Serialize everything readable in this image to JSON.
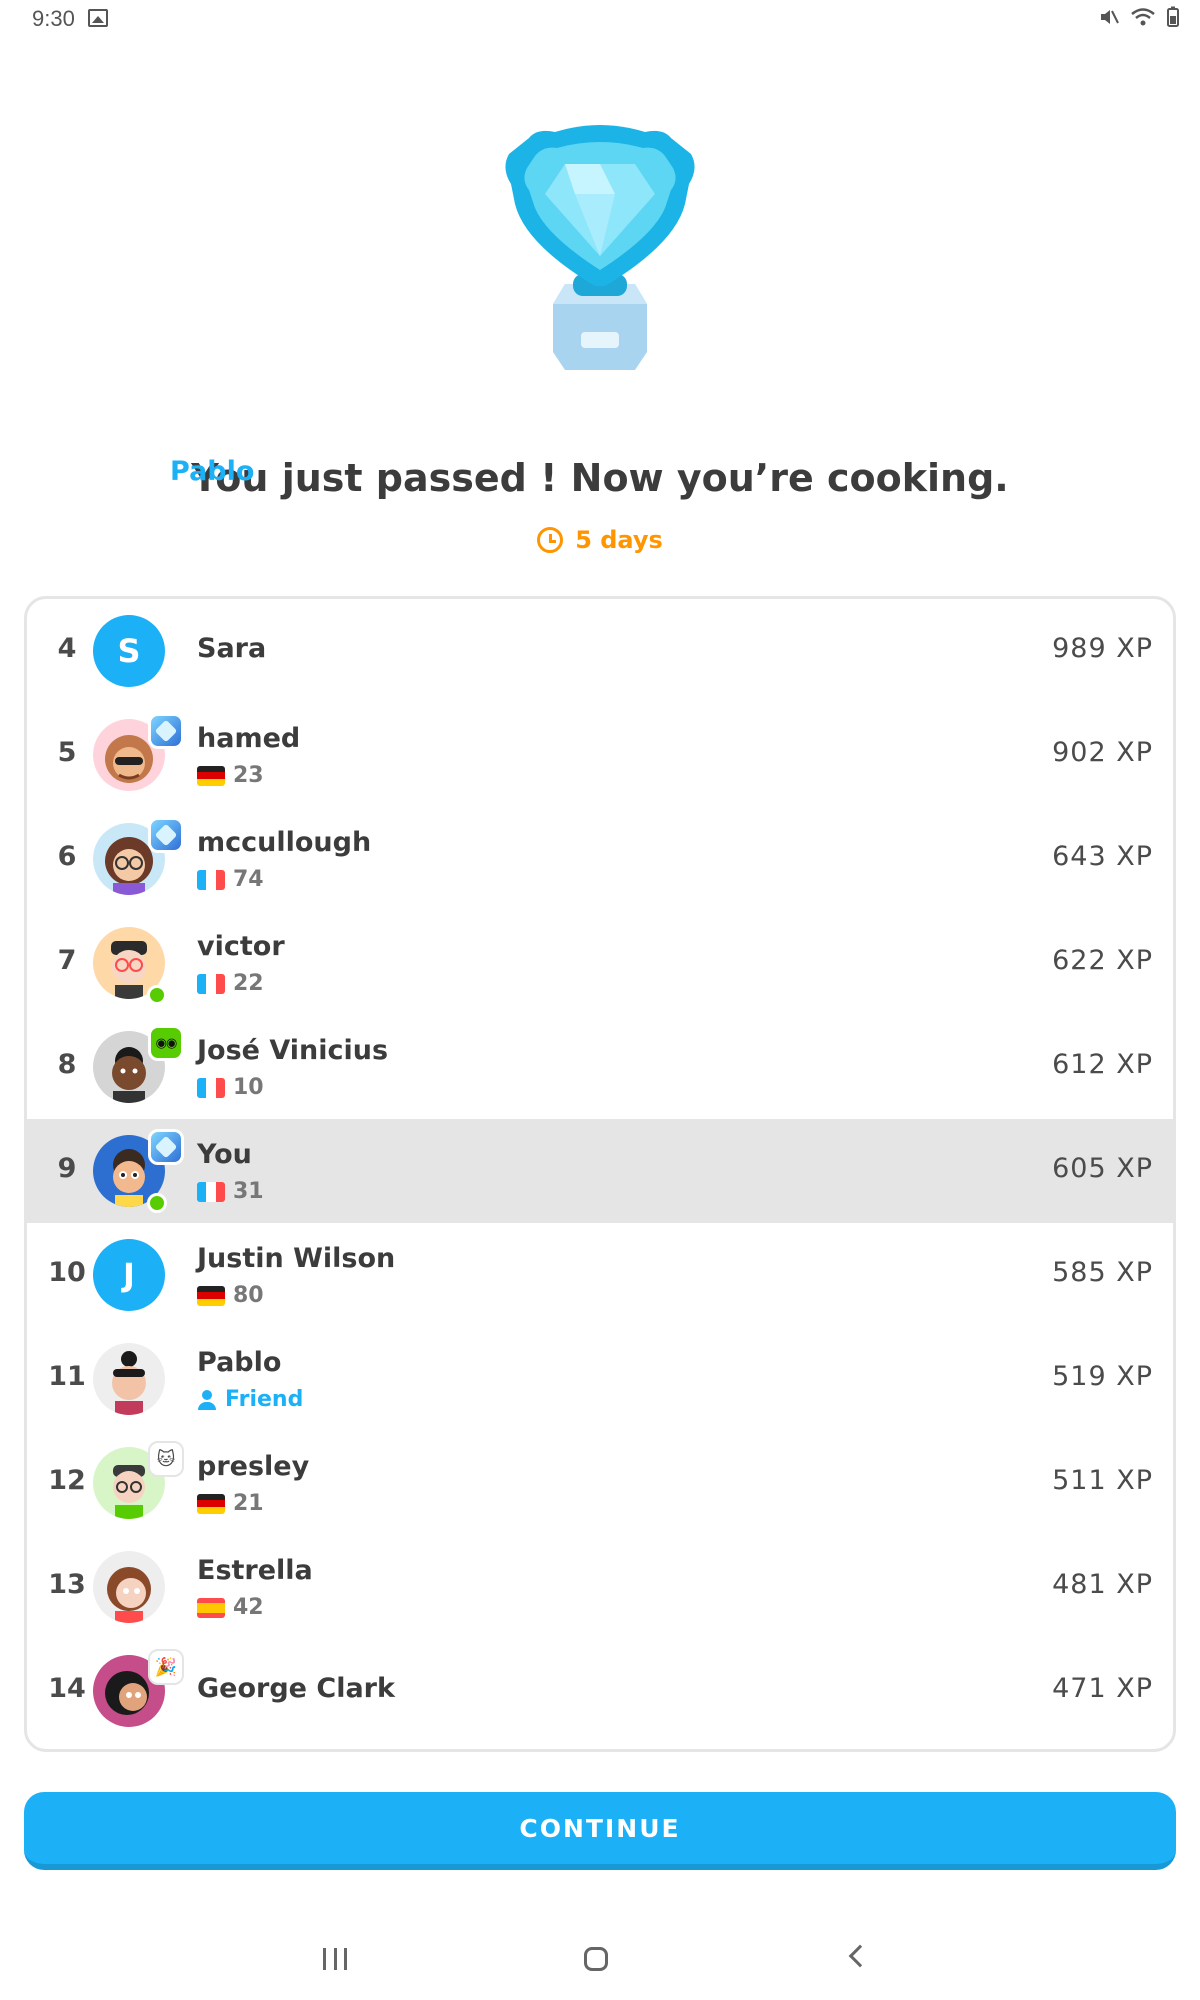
{
  "status_bar": {
    "time": "9:30"
  },
  "headline": {
    "prefix": "You just passed ",
    "name": "Pablo",
    "suffix": "! Now you’re cooking."
  },
  "timer": {
    "label": "5 days"
  },
  "leaderboard": [
    {
      "rank": "4",
      "name": "Sara",
      "xp": "989 XP",
      "avatar_letter": "S"
    },
    {
      "rank": "5",
      "name": "hamed",
      "xp": "902 XP",
      "sub": "23",
      "flag": "germany-flag"
    },
    {
      "rank": "6",
      "name": "mccullough",
      "xp": "643 XP",
      "sub": "74",
      "flag": "france-flag"
    },
    {
      "rank": "7",
      "name": "victor",
      "xp": "622 XP",
      "sub": "22",
      "flag": "france-flag"
    },
    {
      "rank": "8",
      "name": "José Vinicius",
      "xp": "612 XP",
      "sub": "10",
      "flag": "france-flag"
    },
    {
      "rank": "9",
      "name": "You",
      "xp": "605 XP",
      "sub": "31",
      "flag": "france-flag"
    },
    {
      "rank": "10",
      "name": "Justin Wilson",
      "xp": "585 XP",
      "sub": "80",
      "flag": "germany-flag",
      "avatar_letter": "J"
    },
    {
      "rank": "11",
      "name": "Pablo",
      "xp": "519 XP",
      "sub": "Friend"
    },
    {
      "rank": "12",
      "name": "presley",
      "xp": "511 XP",
      "sub": "21",
      "flag": "germany-flag"
    },
    {
      "rank": "13",
      "name": "Estrella",
      "xp": "481 XP",
      "sub": "42",
      "flag": "spain-flag"
    },
    {
      "rank": "14",
      "name": "George Clark",
      "xp": "471 XP"
    }
  ],
  "continue_button": {
    "label": "CONTINUE"
  },
  "colors": {
    "accent": "#1cb0f6",
    "streak": "#ff9600",
    "online": "#58cc02",
    "highlight_row": "#e5e5e5"
  }
}
